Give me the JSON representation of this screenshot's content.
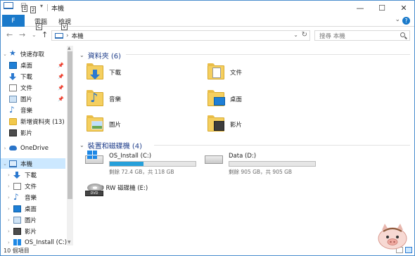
{
  "window": {
    "title": "本機",
    "keytips": [
      "1",
      "2"
    ],
    "controls": {
      "minimize": "—",
      "maximize": "☐",
      "close": "✕"
    }
  },
  "ribbon": {
    "file_tab": "F",
    "tabs": [
      {
        "label": "電腦",
        "keytip": "C"
      },
      {
        "label": "檢視",
        "keytip": "V"
      }
    ],
    "expand": "⌄",
    "help": "?"
  },
  "navigation": {
    "back": "←",
    "forward": "→",
    "recent": "⌄",
    "up": "↑",
    "address_path": "本機",
    "address_sep": "›",
    "search_placeholder": "搜尋 本機"
  },
  "nav_pane": {
    "quick_access": "快速存取",
    "quick_items": [
      {
        "label": "桌面",
        "pinned": true
      },
      {
        "label": "下載",
        "pinned": true
      },
      {
        "label": "文件",
        "pinned": true
      },
      {
        "label": "圖片",
        "pinned": true
      },
      {
        "label": "音樂",
        "pinned": false
      },
      {
        "label": "新增資料夾 (13)",
        "pinned": false
      },
      {
        "label": "影片",
        "pinned": false
      }
    ],
    "onedrive": "OneDrive",
    "this_pc": "本機",
    "pc_items": [
      "下載",
      "文件",
      "音樂",
      "桌面",
      "圖片",
      "影片",
      "OS_Install (C:)"
    ]
  },
  "content": {
    "folders_header": "資料夾 (6)",
    "folders": [
      "下載",
      "文件",
      "音樂",
      "桌面",
      "圖片",
      "影片"
    ],
    "devices_header": "裝置和磁碟機 (4)",
    "drives": [
      {
        "name": "OS_Install (C:)",
        "free": "剩餘 72.4 GB，共 118 GB",
        "used_fraction": 0.39
      },
      {
        "name": "Data (D:)",
        "free": "剩餘 905 GB，共 905 GB",
        "used_fraction": 0.0
      },
      {
        "name": "DVD RW 磁碟機 (E:)"
      }
    ]
  },
  "status": {
    "item_count": "10 個項目"
  },
  "colors": {
    "accent": "#1979ca",
    "selection": "#cce8ff",
    "drive_fill": "#26a0da",
    "group_header": "#1e3d8a"
  }
}
